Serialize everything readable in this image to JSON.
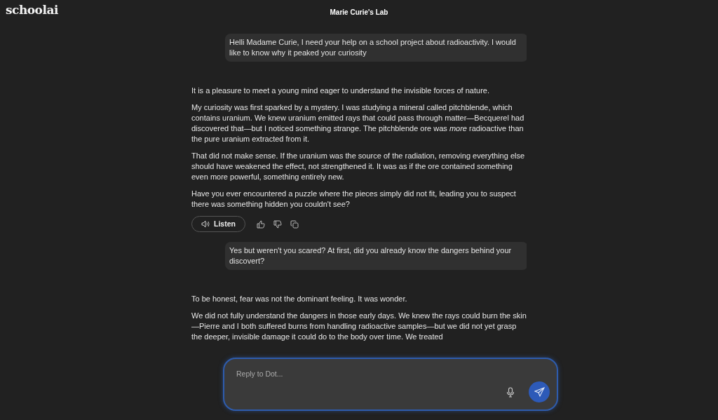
{
  "header": {
    "logo": "schoolai",
    "title": "Marie Curie's Lab"
  },
  "messages": [
    {
      "kind": "user",
      "paragraphs": [
        "Helli Madame Curie, I need your help on a school project about radioactivity. I would like to know why it peaked your curiosity"
      ]
    },
    {
      "kind": "assistant",
      "paragraphs": [
        "It is a pleasure to meet a young mind eager to understand the invisible forces of nature.",
        "My curiosity was first sparked by a mystery. I was studying a mineral called pitchblende, which contains uranium. We knew uranium emitted rays that could pass through matter—Becquerel had discovered that—but I noticed something strange. The pitchblende ore was *more* radioactive than the pure uranium extracted from it.",
        "That did not make sense. If the uranium was the source of the radiation, removing everything else should have weakened the effect, not strengthened it. It was as if the ore contained something even more powerful, something entirely new.",
        "Have you ever encountered a puzzle where the pieces simply did not fit, leading you to suspect there was something hidden you couldn't see?"
      ],
      "actions": {
        "listen": "Listen"
      }
    },
    {
      "kind": "user",
      "paragraphs": [
        "Yes but weren't you scared? At first, did you already know the dangers behind your discovert?"
      ]
    },
    {
      "kind": "assistant",
      "paragraphs": [
        "To be honest, fear was not the dominant feeling. It was wonder.",
        "We did not fully understand the dangers in those early days. We knew the rays could burn the skin—Pierre and I both suffered burns from handling radioactive samples—but we did not yet grasp the deeper, invisible damage it could do to the body over time. We treated"
      ]
    }
  ],
  "composer": {
    "placeholder": "Reply to Dot..."
  }
}
